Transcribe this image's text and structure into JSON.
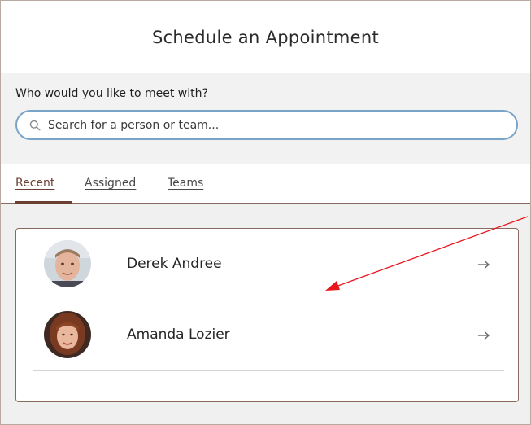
{
  "dialog": {
    "title": "Schedule an Appointment"
  },
  "search": {
    "label": "Who would you like to meet with?",
    "placeholder": "Search for a person or team..."
  },
  "tabs": [
    {
      "label": "Recent",
      "active": true
    },
    {
      "label": "Assigned",
      "active": false
    },
    {
      "label": "Teams",
      "active": false
    }
  ],
  "people": [
    {
      "name": "Derek Andree",
      "avatar_icon": "avatar-derek-andree"
    },
    {
      "name": "Amanda Lozier",
      "avatar_icon": "avatar-amanda-lozier"
    }
  ],
  "colors": {
    "accent": "#6b3f33",
    "search_border": "#7aa4c7",
    "annotation_arrow": "#e8161d"
  },
  "icons": {
    "search": "search-icon",
    "row_arrow": "arrow-right-icon"
  }
}
